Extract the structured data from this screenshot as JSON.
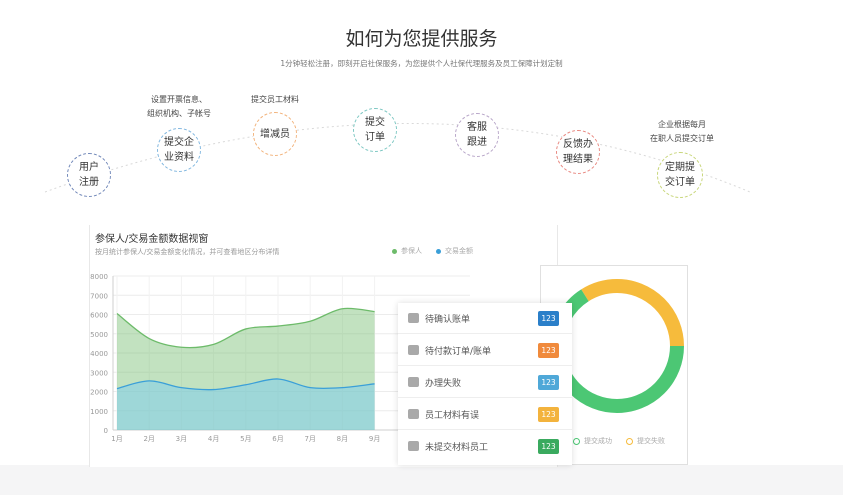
{
  "header": {
    "title": "如何为您提供服务",
    "subtitle": "1分钟轻松注册，即刻开启社保服务，为您提供个人社保代理服务及员工保障计划定制"
  },
  "steps": [
    {
      "label": "用户\n注册",
      "color": "#6f86b8"
    },
    {
      "label": "提交企\n业资料",
      "color": "#7fb6df"
    },
    {
      "label": "增减员",
      "color": "#f2b27a"
    },
    {
      "label": "提交\n订单",
      "color": "#7cc7c2"
    },
    {
      "label": "客服\n跟进",
      "color": "#b7a5c8"
    },
    {
      "label": "反馈办\n理结果",
      "color": "#e8877f"
    },
    {
      "label": "定期提\n交订单",
      "color": "#c8d67a"
    }
  ],
  "notes": {
    "step2": "设置开票信息、\n组织机构、子帐号",
    "step3": "提交员工材料",
    "step7": "企业根据每月\n在职人员提交订单"
  },
  "panel": {
    "title": "参保人/交易金额数据视窗",
    "description": "按月统计参保人/交易金额变化情况，并可查看地区分布详情"
  },
  "chart_data": {
    "type": "area",
    "x": [
      "1月",
      "2月",
      "3月",
      "4月",
      "5月",
      "6月",
      "7月",
      "8月",
      "9月"
    ],
    "yticks": [
      0,
      1000,
      2000,
      3000,
      4000,
      5000,
      6000,
      7000,
      8000
    ],
    "ylim": [
      0,
      8000
    ],
    "legend_position": "top-right",
    "series": [
      {
        "name": "参保人",
        "color": "#6dbb6a",
        "values": [
          6050,
          4750,
          4300,
          4450,
          5250,
          5400,
          5650,
          6300,
          6150
        ]
      },
      {
        "name": "交易金额",
        "color": "#3a9fd8",
        "values": [
          2150,
          2550,
          2200,
          2100,
          2350,
          2650,
          2200,
          2200,
          2400
        ]
      }
    ]
  },
  "todo_items": [
    {
      "label": "待确认账单",
      "count": "123",
      "color": "#2a7fc9"
    },
    {
      "label": "待付款订单/账单",
      "count": "123",
      "color": "#f08a3c"
    },
    {
      "label": "办理失败",
      "count": "123",
      "color": "#4fa8d8"
    },
    {
      "label": "员工材料有误",
      "count": "123",
      "color": "#f3b33d"
    },
    {
      "label": "未提交材料员工",
      "count": "123",
      "color": "#3aaa5f"
    }
  ],
  "donut": {
    "colors": {
      "success": "#4cc774",
      "fail": "#f6bb3c"
    },
    "success_fraction": 0.66,
    "legend": [
      {
        "label": "提交成功",
        "color": "#4cc774"
      },
      {
        "label": "提交失败",
        "color": "#f6bb3c"
      }
    ]
  }
}
